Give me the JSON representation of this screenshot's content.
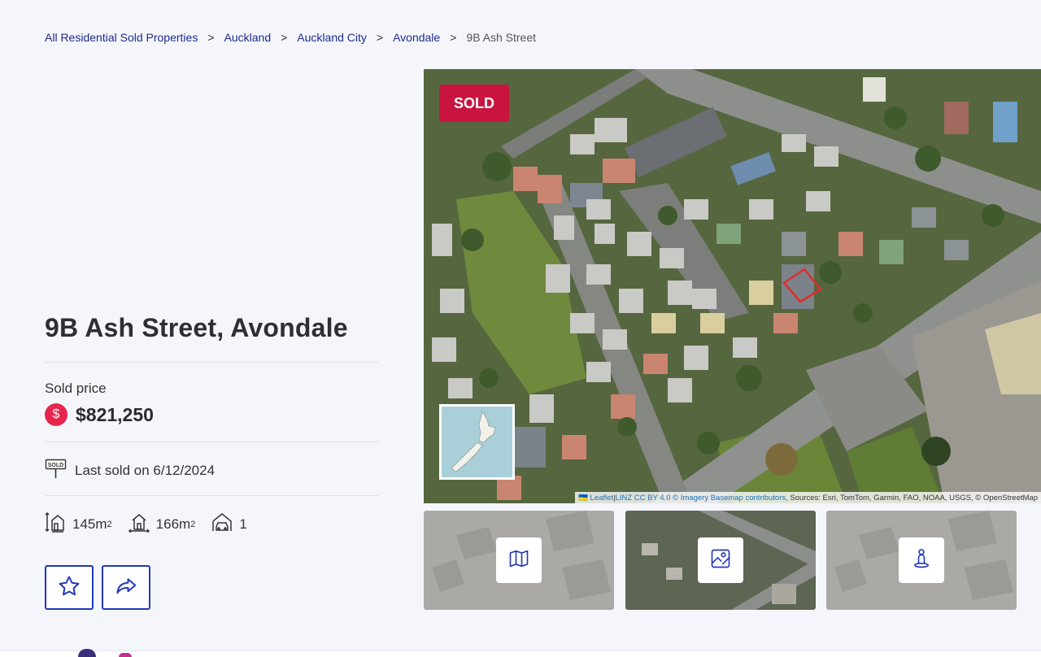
{
  "breadcrumb": {
    "items": [
      "All Residential Sold Properties",
      "Auckland",
      "Auckland City",
      "Avondale"
    ],
    "separator": ">",
    "current": "9B Ash Street"
  },
  "property": {
    "title": "9B Ash Street, Avondale",
    "sold_price_label": "Sold price",
    "price": "$821,250",
    "currency_symbol": "$",
    "last_sold": "Last sold on 6/12/2024",
    "sold_sign_text": "SOLD",
    "floor_area": "145m",
    "land_area": "166m",
    "area_unit_power": "2",
    "garages": "1"
  },
  "map": {
    "badge": "SOLD",
    "attribution_flag": "🇺🇦",
    "attribution_leaflet": "Leaflet",
    "attribution_sep": " | ",
    "attribution_linz": "LINZ CC BY 4.0 © Imagery Basemap contributors",
    "attribution_rest": ", Sources: Esri, TomTom, Garmin, FAO, NOAA, USGS, © OpenStreetMap"
  },
  "thumbnails": [
    {
      "name": "map-view",
      "icon": "map-icon"
    },
    {
      "name": "satellite-view",
      "icon": "satellite-icon"
    },
    {
      "name": "street-view",
      "icon": "person-pin-icon"
    }
  ],
  "colors": {
    "accent": "#c8143f",
    "link": "#1f2a8c",
    "button_border": "#2238b8",
    "price_icon": "#e8264d",
    "background": "#f4f6fb"
  }
}
